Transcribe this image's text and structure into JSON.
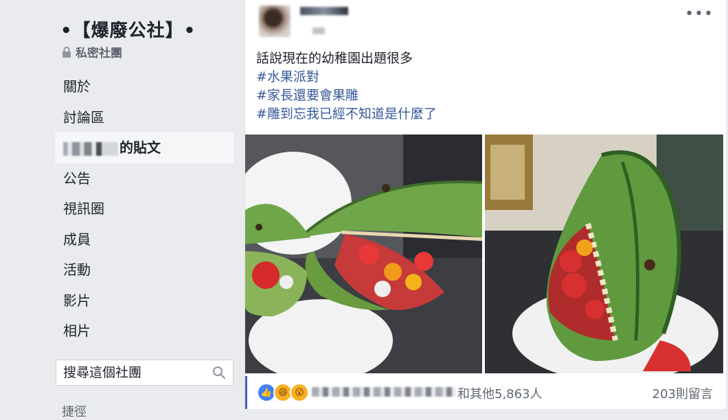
{
  "sidebar": {
    "group_name": "•【爆廢公社】•",
    "privacy_label": "私密社團",
    "nav": [
      {
        "label": "關於"
      },
      {
        "label": "討論區"
      },
      {
        "label": "的貼文"
      },
      {
        "label": "公告"
      },
      {
        "label": "視訊圈"
      },
      {
        "label": "成員"
      },
      {
        "label": "活動"
      },
      {
        "label": "影片"
      },
      {
        "label": "相片"
      }
    ],
    "search_placeholder": "搜尋這個社團",
    "truncated_item": "捷徑"
  },
  "post": {
    "text_line": "話說現在的幼稚園出題很多",
    "hashtags": [
      "#水果派對",
      "#家長還要會果雕",
      "#雕到忘我已經不知道是什麼了"
    ],
    "reactions_suffix": "和其他5,863人",
    "comments": "203則留言",
    "reaction_icons": [
      "like-icon",
      "haha-icon",
      "wow-icon"
    ]
  },
  "colors": {
    "link": "#365899",
    "like": "#4080ff",
    "accent_bar": "#4267b2"
  }
}
